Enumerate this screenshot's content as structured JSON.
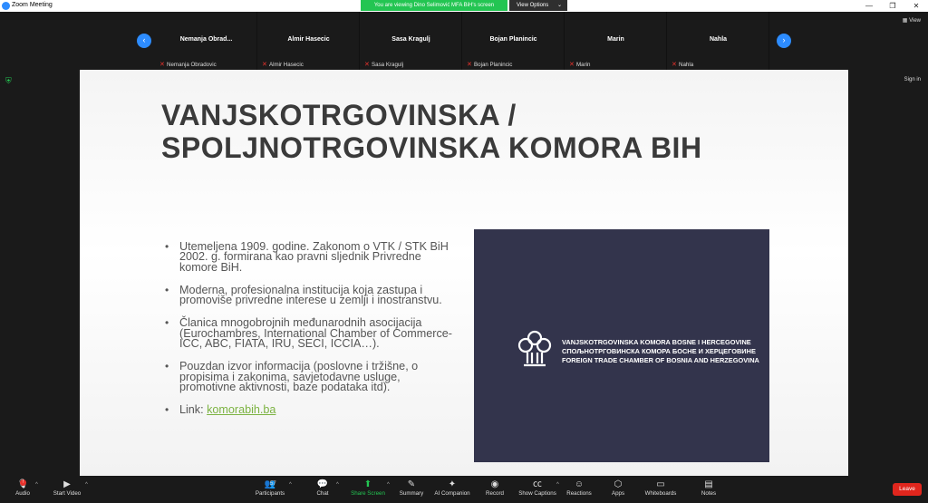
{
  "window": {
    "title": "Zoom Meeting",
    "controls": [
      "—",
      "❐",
      "✕"
    ]
  },
  "share_banner": {
    "text": "You are viewing Dino Selimović MFA BiH's screen"
  },
  "view_options": {
    "label": "View Options",
    "chevron": "⌄"
  },
  "view_button": {
    "label": "View"
  },
  "sign_in": {
    "label": "Sign in"
  },
  "nav": {
    "prev": "‹",
    "next": "›"
  },
  "participants": [
    {
      "name": "Nemanja  Obrad...",
      "label": "Nemanja Obradovic"
    },
    {
      "name": "Almir Hasecic",
      "label": "Almir Hasecic"
    },
    {
      "name": "Sasa Kragulj",
      "label": "Sasa Kragulj"
    },
    {
      "name": "Bojan Planincic",
      "label": "Bojan Planincic"
    },
    {
      "name": "Marin",
      "label": "Marin"
    },
    {
      "name": "Nahla",
      "label": "Nahla"
    }
  ],
  "slide": {
    "heading_line1": "VANJSKOTRGOVINSKA /",
    "heading_line2": "SPOLJNOTRGOVINSKA KOMORA BIH",
    "bullets": [
      "Utemeljena 1909. godine. Zakonom o VTK / STK BiH 2002. g. formirana kao pravni sljednik Privredne komore BiH.",
      "Moderna, profesionalna institucija koja zastupa i promoviše privredne interese u zemlji i inostranstvu.",
      "Članica mnogobrojnih međunarodnih asocijacija (Eurochambres, International Chamber of Commerce-ICC, ABC, FIATA, IRU, SECI, ICCIA…).",
      "Pouzdan izvor informacija (poslovne i tržišne, o propisima i zakonima, savjetodavne usluge, promotivne aktivnosti, baze podataka itd)."
    ],
    "link_prefix": "Link: ",
    "link_text": "komorabih.ba",
    "logo_line1": "VANJSKOTRGOVINSKA KOMORA BOSNE I HERCEGOVINE",
    "logo_line2": "СПОЉНОТРГОВИНСКА КОМОРА БОСНЕ И ХЕРЦЕГОВИНЕ",
    "logo_line3": "FOREIGN TRADE CHAMBER OF BOSNIA AND HERZEGOVINA"
  },
  "toolbar": {
    "audio": "Audio",
    "audio_badge": "!",
    "start_video": "Start Video",
    "participants": "Participants",
    "participants_count": "57",
    "chat": "Chat",
    "share_screen": "Share Screen",
    "summary": "Summary",
    "ai_companion": "AI Companion",
    "record": "Record",
    "show_captions": "Show Captions",
    "reactions": "Reactions",
    "apps": "Apps",
    "whiteboards": "Whiteboards",
    "notes": "Notes",
    "leave": "Leave"
  },
  "colors": {
    "accent": "#2d8cff",
    "share_green": "#23c552",
    "leave_red": "#e0261d",
    "logo_bg": "#33344c",
    "link_green": "#7cb342"
  }
}
